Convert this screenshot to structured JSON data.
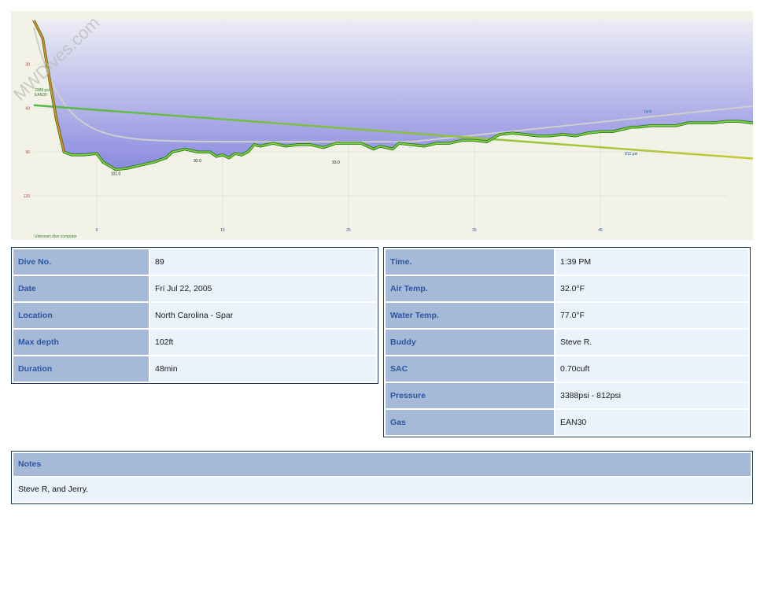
{
  "watermark": "MWDives.com",
  "chart_data": {
    "type": "area",
    "x_ticks": [
      5,
      15,
      25,
      35,
      45
    ],
    "y_ticks": [
      30,
      60,
      90,
      120
    ],
    "xlim": [
      0,
      53
    ],
    "ylim": [
      145,
      0
    ],
    "y_inverted": true,
    "grid": true,
    "depth_profile": [
      [
        0,
        0
      ],
      [
        0.7,
        12
      ],
      [
        1.2,
        38
      ],
      [
        1.8,
        68
      ],
      [
        2.4,
        90
      ],
      [
        3,
        92
      ],
      [
        4,
        92
      ],
      [
        5,
        91
      ],
      [
        5.5,
        97
      ],
      [
        6.5,
        102
      ],
      [
        7.5,
        101
      ],
      [
        8.5,
        99
      ],
      [
        9.5,
        97
      ],
      [
        10.5,
        94
      ],
      [
        11,
        90
      ],
      [
        12,
        88
      ],
      [
        13,
        90
      ],
      [
        14,
        90
      ],
      [
        14.5,
        93
      ],
      [
        15,
        92
      ],
      [
        15.5,
        94
      ],
      [
        16,
        91
      ],
      [
        16.5,
        92
      ],
      [
        17,
        90
      ],
      [
        17.5,
        85
      ],
      [
        18,
        86
      ],
      [
        19,
        84
      ],
      [
        20,
        86
      ],
      [
        21,
        85
      ],
      [
        22,
        85
      ],
      [
        23,
        87
      ],
      [
        24,
        84
      ],
      [
        25,
        84
      ],
      [
        26,
        84
      ],
      [
        27,
        88
      ],
      [
        27.5,
        86
      ],
      [
        28.5,
        88
      ],
      [
        29,
        84
      ],
      [
        30,
        85
      ],
      [
        31,
        86
      ],
      [
        32,
        84
      ],
      [
        33,
        84
      ],
      [
        34,
        82
      ],
      [
        35,
        82
      ],
      [
        36,
        83
      ],
      [
        37,
        78
      ],
      [
        38,
        77
      ],
      [
        39,
        78
      ],
      [
        40,
        79
      ],
      [
        41,
        79
      ],
      [
        42,
        78
      ],
      [
        43,
        79
      ],
      [
        44,
        77
      ],
      [
        45,
        76
      ],
      [
        46,
        76
      ],
      [
        47,
        74
      ],
      [
        47.5,
        73
      ],
      [
        48,
        73
      ],
      [
        49,
        72
      ],
      [
        50,
        72
      ],
      [
        51,
        72
      ],
      [
        52,
        70
      ],
      [
        53,
        70
      ],
      [
        54,
        70
      ],
      [
        55,
        69
      ],
      [
        56,
        69
      ],
      [
        57,
        70
      ],
      [
        58,
        69
      ],
      [
        59,
        68
      ],
      [
        59.5,
        66
      ],
      [
        60,
        63
      ],
      [
        60.5,
        62
      ]
    ],
    "depth_markers": [
      {
        "x": 6.5,
        "depth": 101.0,
        "label": "101.0"
      },
      {
        "x": 13,
        "depth": 92.0,
        "label": "92.0"
      },
      {
        "x": 24,
        "depth": 93.0,
        "label": "93.0"
      }
    ],
    "pressure_series": {
      "start_label": "3388 psi",
      "end_label": "812 psi",
      "start_depth": 58,
      "end_depth": 96
    },
    "start_gas": "EAN30",
    "temperature_label": "74°F",
    "footnote": "Unknown dive computer",
    "colors": {
      "fill_top": "#ececf6",
      "fill_bottom": "#8a8ae0",
      "background": "#f2f2e6",
      "profile_light": "#7ccf3a",
      "profile_dark": "#1f6b1f",
      "ascent_fast": "#d98a1e",
      "pressure_start": "#55b84a",
      "pressure_end": "#c9c935",
      "temperature": "#cccccc",
      "axis_label": "#cc3333"
    }
  },
  "details_left": [
    {
      "label": "Dive No.",
      "value": "89"
    },
    {
      "label": "Date",
      "value": "Fri Jul 22, 2005"
    },
    {
      "label": "Location",
      "value": "North Carolina - Spar"
    },
    {
      "label": "Max depth",
      "value": "102ft"
    },
    {
      "label": "Duration",
      "value": "48min"
    }
  ],
  "details_right": [
    {
      "label": "Time.",
      "value": "1:39 PM"
    },
    {
      "label": "Air Temp.",
      "value": "32.0°F"
    },
    {
      "label": "Water Temp.",
      "value": "77.0°F"
    },
    {
      "label": "Buddy",
      "value": "Steve R."
    },
    {
      "label": "SAC",
      "value": "0.70cuft"
    },
    {
      "label": "Pressure",
      "value": "3388psi - 812psi"
    },
    {
      "label": "Gas",
      "value": "EAN30"
    }
  ],
  "notes": {
    "title": "Notes",
    "text": "Steve R, and Jerry."
  }
}
